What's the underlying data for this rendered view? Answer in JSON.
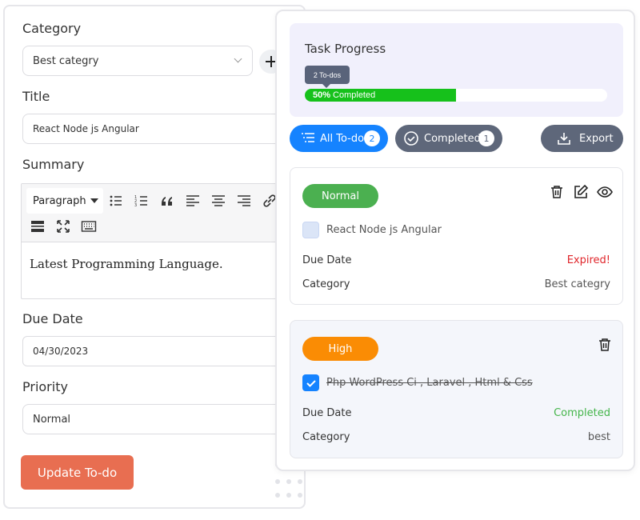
{
  "form": {
    "category_label": "Category",
    "category_value": "Best categry",
    "title_label": "Title",
    "title_value": "React Node js Angular",
    "summary_label": "Summary",
    "editor": {
      "paragraph_select": "Paragraph",
      "content": "Latest Programming Language."
    },
    "due_date_label": "Due Date",
    "due_date_value": "04/30/2023",
    "priority_label": "Priority",
    "priority_value": "Normal",
    "submit_label": "Update To-do"
  },
  "progress": {
    "title": "Task Progress",
    "tooltip": "2 To-dos",
    "percent": 50,
    "percent_label": "50%",
    "completed_word": "Completed"
  },
  "filters": {
    "all_label": "All To-do",
    "all_count": "2",
    "completed_label": "Completed",
    "completed_count": "1",
    "export_label": "Export"
  },
  "todos": [
    {
      "priority": "Normal",
      "priority_color": "#4bb050",
      "title": "React Node js Angular",
      "done": false,
      "due_label": "Due Date",
      "due_value": "Expired!",
      "due_color": "#e0262b",
      "category_label": "Category",
      "category_value": "Best categry"
    },
    {
      "priority": "High",
      "priority_color": "#fa8c04",
      "title": "Php WordPress Ci , Laravel , Html & Css",
      "done": true,
      "due_label": "Due Date",
      "due_value": "Completed",
      "due_color": "#44b54a",
      "category_label": "Category",
      "category_value": "best"
    }
  ],
  "icons": {
    "plus": "plus-icon",
    "trash": "trash-icon",
    "edit": "edit-icon",
    "view": "eye-icon",
    "calendar": "calendar-icon",
    "export": "download-icon",
    "filter": "list-filter-icon",
    "check_circle": "check-circle-icon"
  },
  "colors": {
    "primary": "#1583ff",
    "secondary": "#5e677a",
    "progress": "#16c11b",
    "submit": "#e86e51"
  }
}
